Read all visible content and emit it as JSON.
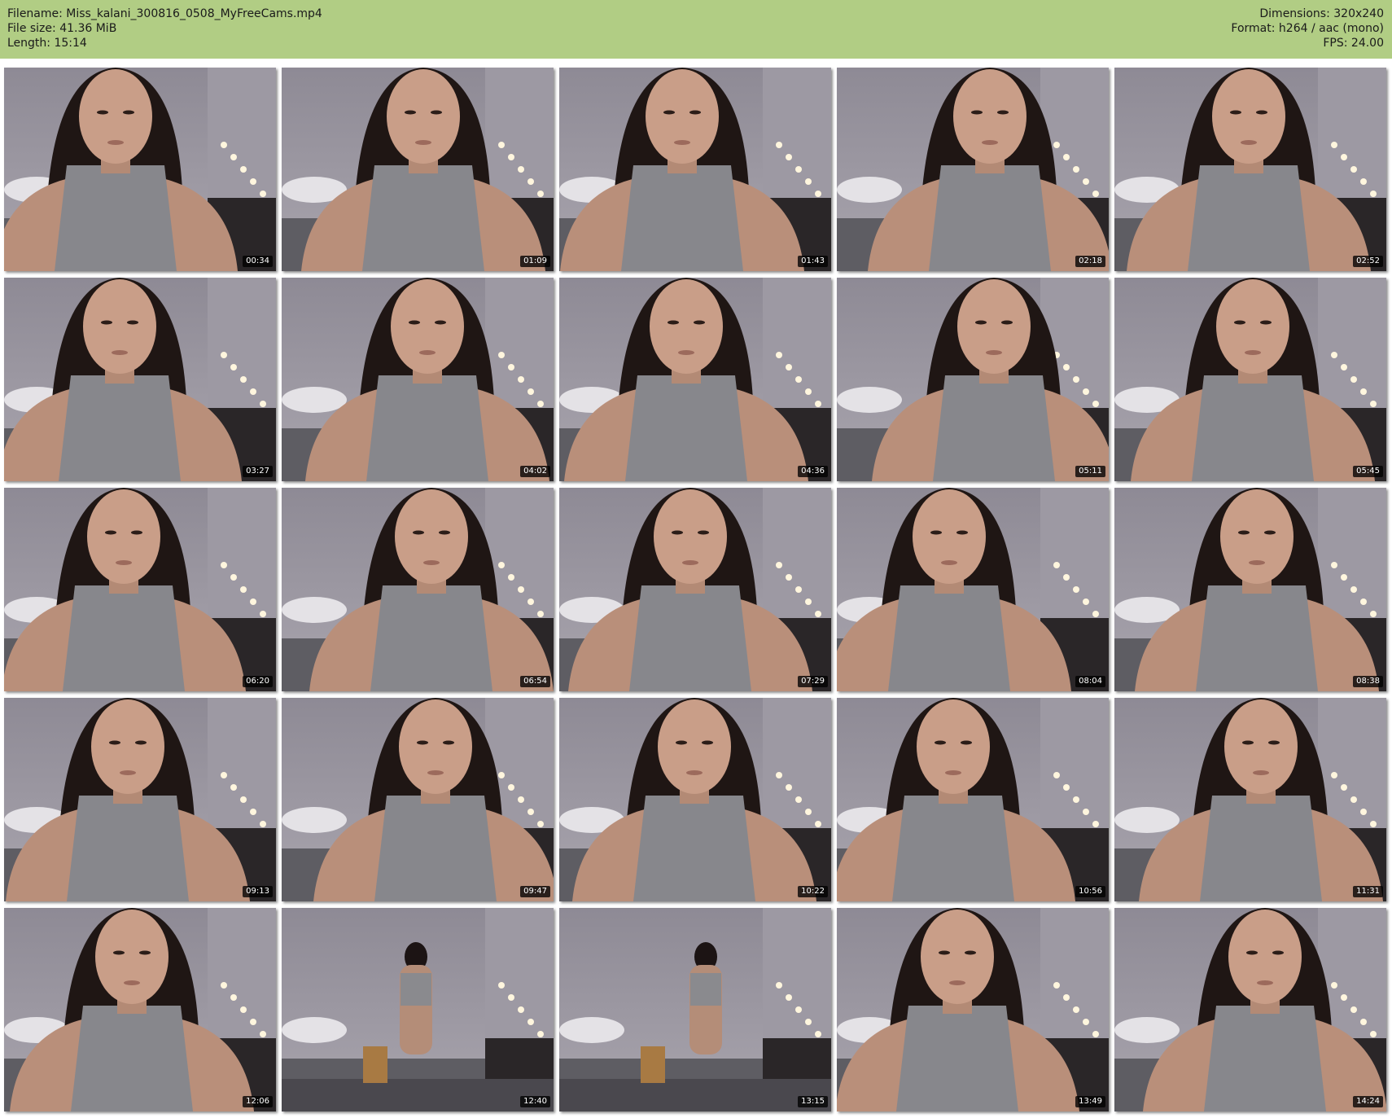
{
  "file_info": {
    "filename_line": "Filename: Miss_kalani_300816_0508_MyFreeCams.mp4",
    "filesize_line": "File size: 41.36 MiB",
    "length_line": "Length: 15:14",
    "dimensions_line": "Dimensions: 320x240",
    "format_line": "Format: h264 / aac (mono)",
    "fps_line": "FPS: 24.00"
  },
  "colors": {
    "header_background": "#b1cd84",
    "page_background": "#ffffff",
    "timestamp_background": "#000000",
    "timestamp_text": "#ffffff"
  },
  "grid": {
    "columns": 5,
    "rows": 5
  },
  "thumbnails": [
    {
      "timestamp": "00:34"
    },
    {
      "timestamp": "01:09"
    },
    {
      "timestamp": "01:43"
    },
    {
      "timestamp": "02:18"
    },
    {
      "timestamp": "02:52"
    },
    {
      "timestamp": "03:27"
    },
    {
      "timestamp": "04:02"
    },
    {
      "timestamp": "04:36"
    },
    {
      "timestamp": "05:11"
    },
    {
      "timestamp": "05:45"
    },
    {
      "timestamp": "06:20"
    },
    {
      "timestamp": "06:54"
    },
    {
      "timestamp": "07:29"
    },
    {
      "timestamp": "08:04"
    },
    {
      "timestamp": "08:38"
    },
    {
      "timestamp": "09:13"
    },
    {
      "timestamp": "09:47"
    },
    {
      "timestamp": "10:22"
    },
    {
      "timestamp": "10:56"
    },
    {
      "timestamp": "11:31"
    },
    {
      "timestamp": "12:06"
    },
    {
      "timestamp": "12:40"
    },
    {
      "timestamp": "13:15"
    },
    {
      "timestamp": "13:49"
    },
    {
      "timestamp": "14:24"
    }
  ]
}
